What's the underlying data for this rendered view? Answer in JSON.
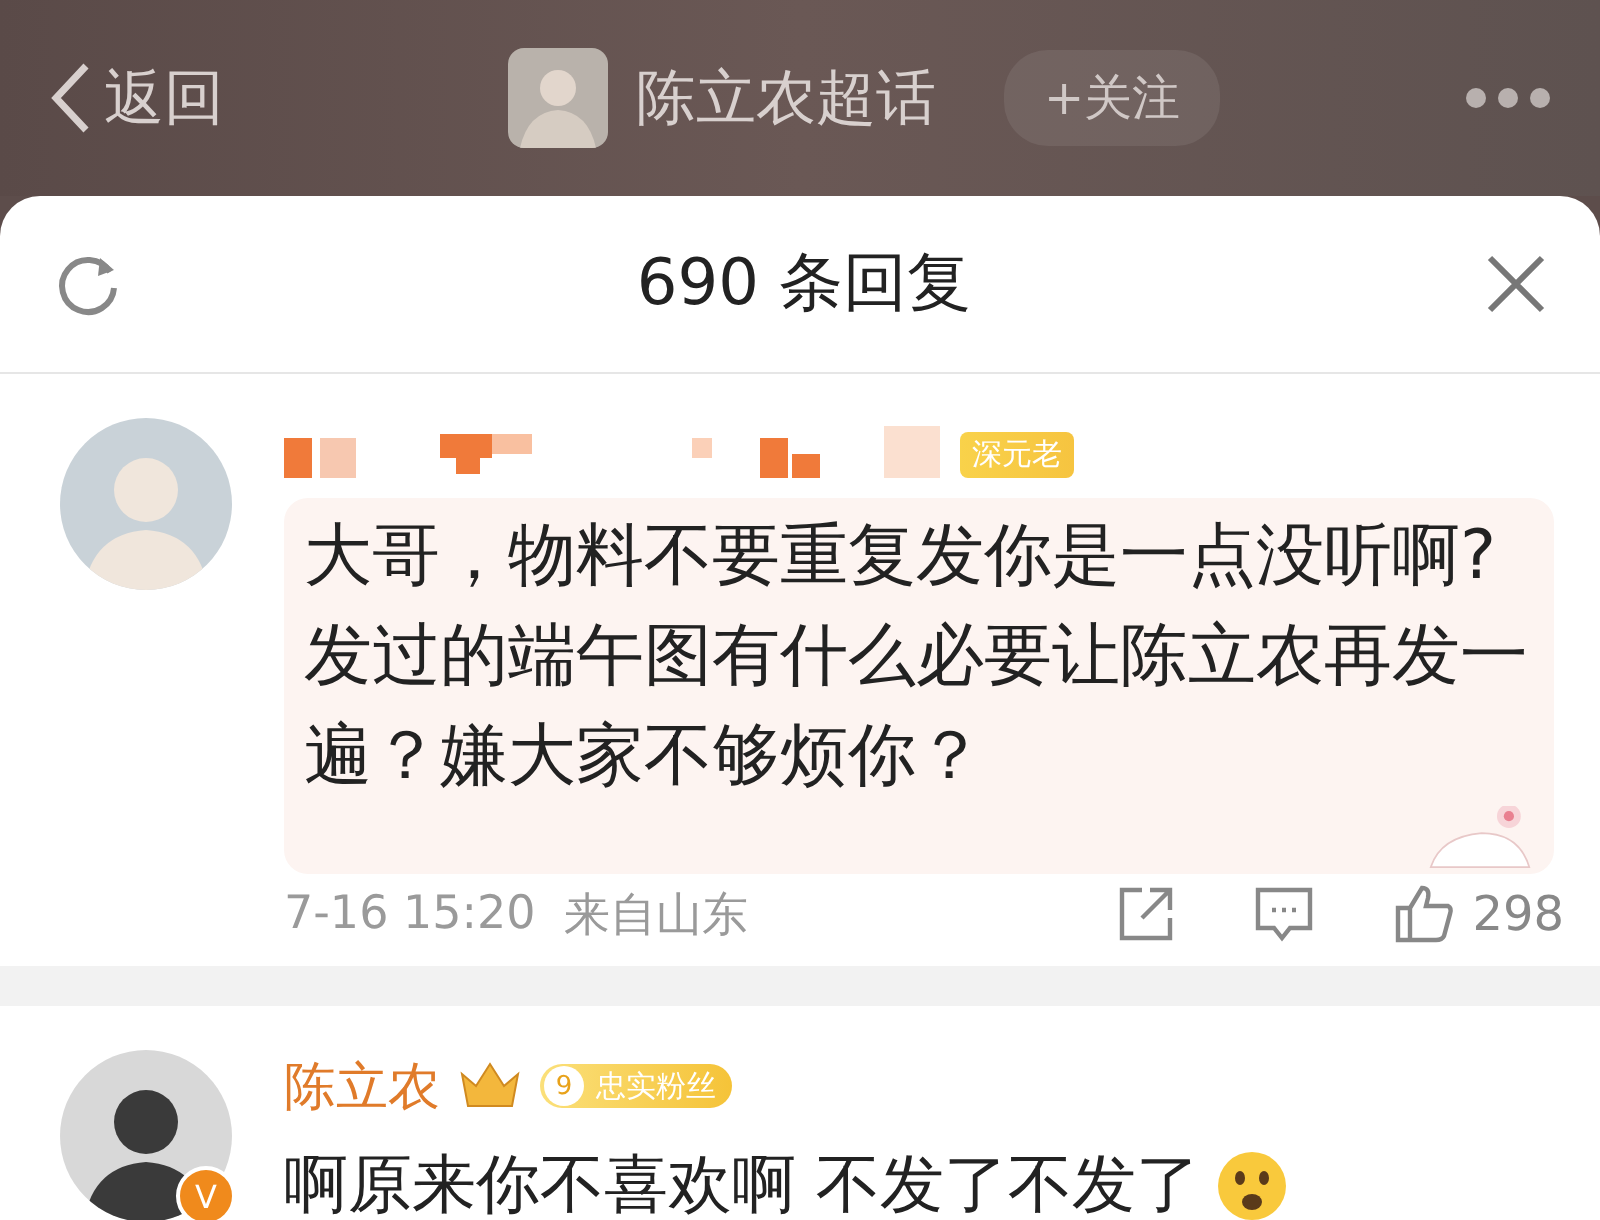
{
  "top_bar": {
    "back_label": "返回",
    "topic": "陈立农超话",
    "follow_button": "+关注"
  },
  "sheet": {
    "title": "690 条回复"
  },
  "comments": [
    {
      "kind": "reader",
      "badge": "深元老",
      "text": "大哥，物料不要重复发你是一点没听啊?发过的端午图有什么必要让陈立农再发一遍？嫌大家不够烦你？",
      "time": "7-16 15:20",
      "location": "来自山东",
      "likes": "298"
    },
    {
      "kind": "star",
      "name": "陈立农",
      "verified": "V",
      "fan_level": "9",
      "fan_badge": "忠实粉丝",
      "text": "啊原来你不喜欢啊 不发了不发了"
    }
  ]
}
